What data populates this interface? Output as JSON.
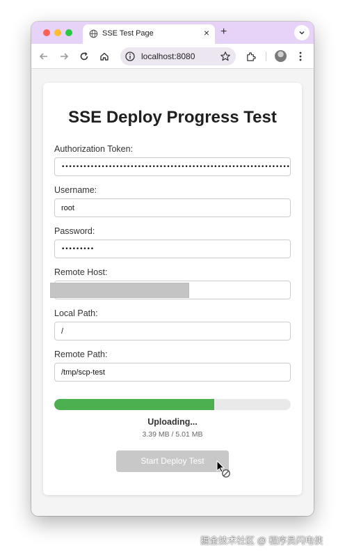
{
  "browser": {
    "tab_title": "SSE Test Page",
    "tab_close": "×",
    "new_tab": "+",
    "url": "localhost:8080"
  },
  "page": {
    "title": "SSE Deploy Progress Test",
    "fields": [
      {
        "label": "Authorization Token:",
        "value": "••••••••••••••••••••••••••••••••••••••••••••••••••••••••••••••••••••••••••"
      },
      {
        "label": "Username:",
        "value": "root"
      },
      {
        "label": "Password:",
        "value": "•••••••••"
      },
      {
        "label": "Remote Host:",
        "value": ""
      },
      {
        "label": "Local Path:",
        "value": "/"
      },
      {
        "label": "Remote Path:",
        "value": "/tmp/scp-test"
      }
    ],
    "progress": {
      "fraction": 0.676,
      "status": "Uploading...",
      "size": "3.39 MB / 5.01 MB"
    },
    "button_label": "Start Deploy Test"
  },
  "watermark": "掘金技术社区 @ 程序员闪电侠",
  "colors": {
    "progress": "#4caf50",
    "tabbar": "#e6d3f7",
    "button_disabled": "#c8c8c8"
  }
}
